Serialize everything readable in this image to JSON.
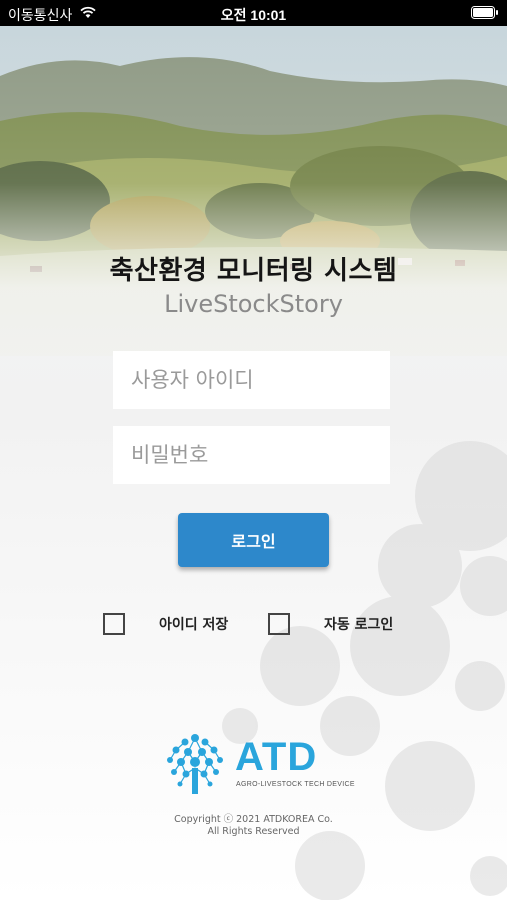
{
  "status_bar": {
    "carrier": "이동통신사",
    "time": "오전 10:01",
    "wifi_icon": "wifi-icon",
    "battery_icon": "battery-icon"
  },
  "header": {
    "title": "축산환경 모니터링 시스템",
    "subtitle": "LiveStockStory"
  },
  "form": {
    "userid_placeholder": "사용자 아이디",
    "password_placeholder": "비밀번호",
    "userid_value": "",
    "password_value": "",
    "login_label": "로그인",
    "save_id_label": "아이디 저장",
    "save_id_checked": false,
    "auto_login_label": "자동 로그인",
    "auto_login_checked": false,
    "login_button_color": "#2d88cb"
  },
  "footer": {
    "logo_text": "ATD",
    "logo_tagline": "AGRO-LIVESTOCK TECH DEVICE",
    "copyright_line1": "Copyright ⓒ 2021 ATDKOREA Co.",
    "copyright_line2": "All Rights Reserved",
    "brand_color": "#2aa5dc"
  }
}
